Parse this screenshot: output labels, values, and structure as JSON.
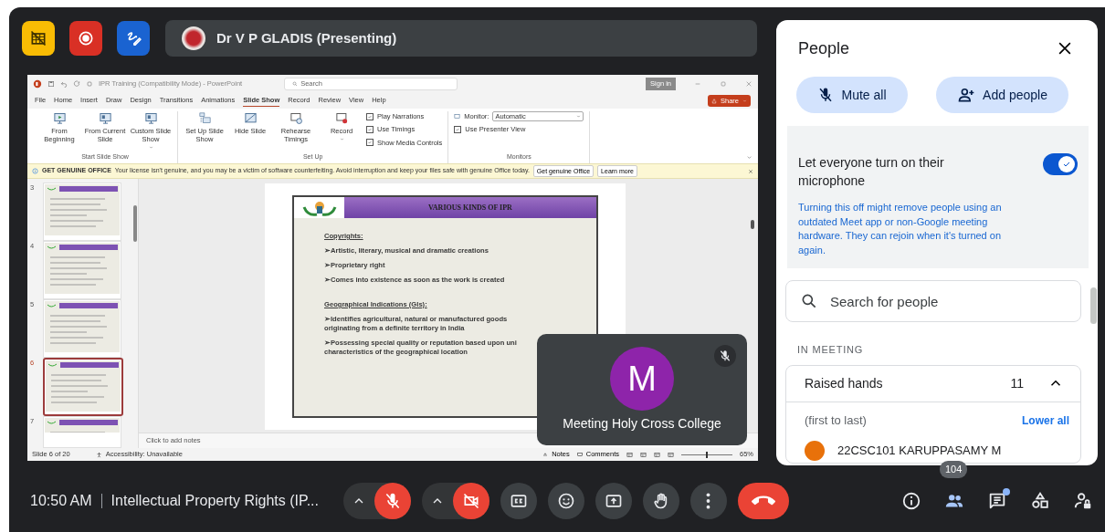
{
  "header_buttons": [
    {
      "kind": "layout-off"
    },
    {
      "kind": "recording"
    },
    {
      "kind": "annotate"
    }
  ],
  "presenter": {
    "name": "Dr V P GLADIS (Presenting)"
  },
  "shared_screen": {
    "title": "IPR Training (Compatibility Mode) - PowerPoint",
    "search": {
      "placeholder": "Search"
    },
    "sign_in": "Sign in",
    "tabs": [
      {
        "label": "File",
        "selected": false
      },
      {
        "label": "Home",
        "selected": false
      },
      {
        "label": "Insert",
        "selected": false
      },
      {
        "label": "Draw",
        "selected": false
      },
      {
        "label": "Design",
        "selected": false
      },
      {
        "label": "Transitions",
        "selected": false
      },
      {
        "label": "Animations",
        "selected": false
      },
      {
        "label": "Slide Show",
        "selected": true
      },
      {
        "label": "Record",
        "selected": false
      },
      {
        "label": "Review",
        "selected": false
      },
      {
        "label": "View",
        "selected": false
      },
      {
        "label": "Help",
        "selected": false
      }
    ],
    "share": "Share",
    "ribbon_groups": [
      {
        "label": "Start Slide Show",
        "items": [
          {
            "kind": "large",
            "label": "From Beginning"
          },
          {
            "kind": "large",
            "label": "From Current Slide"
          },
          {
            "kind": "menu",
            "label": "Custom Slide Show"
          }
        ]
      },
      {
        "label": "Set Up",
        "items": [
          {
            "kind": "large",
            "label": "Set Up Slide Show"
          },
          {
            "kind": "large",
            "label": "Hide Slide"
          },
          {
            "kind": "large",
            "label": "Rehearse Timings"
          },
          {
            "kind": "menu",
            "label": "Record"
          },
          {
            "kind": "check",
            "label": "Play Narrations",
            "checked": true
          },
          {
            "kind": "check",
            "label": "Use Timings",
            "checked": true
          },
          {
            "kind": "check",
            "label": "Show Media Controls",
            "checked": true
          }
        ]
      },
      {
        "label": "Monitors",
        "items": [
          {
            "kind": "select",
            "label": "Monitor:",
            "value": "Automatic"
          },
          {
            "kind": "check",
            "label": "Use Presenter View",
            "checked": true
          }
        ]
      }
    ],
    "info_bar": {
      "title": "GET GENUINE OFFICE",
      "message": "Your license isn't genuine, and you may be a victim of software counterfeiting. Avoid interruption and keep your files safe with genuine Office today.",
      "buttons": [
        "Get genuine Office",
        "Learn more"
      ]
    },
    "thumbnails": [
      {
        "number": "3",
        "selected": false
      },
      {
        "number": "4",
        "selected": false
      },
      {
        "number": "5",
        "selected": false
      },
      {
        "number": "6",
        "selected": true
      },
      {
        "number": "7",
        "selected": false
      }
    ],
    "slide": {
      "title": "VARIOUS KINDS OF IPR",
      "sections": [
        {
          "heading": "Copyrights:",
          "bullets": [
            {
              "lines": [
                "➢Artistic, literary, musical and dramatic creations"
              ]
            },
            {
              "lines": [
                "➢Proprietary right"
              ]
            },
            {
              "lines": [
                "➢Comes into existence as soon as the work is created"
              ]
            }
          ]
        },
        {
          "heading": "Geographical Indications (GIs):",
          "bullets": [
            {
              "lines": [
                "➢Identifies agricultural, natural or manufactured goods",
                "originating from a definite territory in India"
              ]
            },
            {
              "lines": [
                "➢Possessing special quality or reputation based upon uni",
                "characteristics of the geographical location"
              ]
            }
          ]
        }
      ]
    },
    "notes_placeholder": "Click to add notes",
    "status": {
      "slide": "Slide 6 of 20",
      "accessibility": "Accessibility: Unavailable",
      "notes": "Notes",
      "comments": "Comments",
      "zoom": "65%",
      "zoom_slider": {
        "level": 0.5
      }
    }
  },
  "participant_tile": {
    "initial": "M",
    "name": "Meeting Holy Cross College",
    "muted": true
  },
  "people_panel": {
    "title": "People",
    "actions": [
      {
        "kind": "mute",
        "label": "Mute all"
      },
      {
        "kind": "add",
        "label": "Add people"
      }
    ],
    "setting": {
      "label": "Let everyone turn on their microphone",
      "on": true,
      "description": "Turning this off might remove people using an outdated Meet app or non-Google meeting hardware. They can rejoin when it's turned on again."
    },
    "search": {
      "placeholder": "Search for people"
    },
    "section": "IN MEETING",
    "raised_hands": {
      "label": "Raised hands",
      "count": "11",
      "expanded": true,
      "order": "(first to last)",
      "action": "Lower all",
      "people": [
        {
          "name": "22CSC101 KARUPPASAMY M"
        }
      ]
    }
  },
  "bottom_bar": {
    "time": "10:50 AM",
    "meeting_title": "Intellectual Property Rights (IP...",
    "controls": [
      {
        "kind": "mic",
        "off": true,
        "menu": true
      },
      {
        "kind": "camera",
        "off": true,
        "menu": true
      },
      {
        "kind": "captions"
      },
      {
        "kind": "reactions"
      },
      {
        "kind": "present"
      },
      {
        "kind": "raise-hand"
      },
      {
        "kind": "more"
      },
      {
        "kind": "leave"
      }
    ],
    "side": [
      {
        "kind": "info"
      },
      {
        "kind": "people",
        "badge": "104"
      },
      {
        "kind": "chat",
        "unread": true
      },
      {
        "kind": "activities"
      },
      {
        "kind": "host-controls"
      }
    ]
  }
}
